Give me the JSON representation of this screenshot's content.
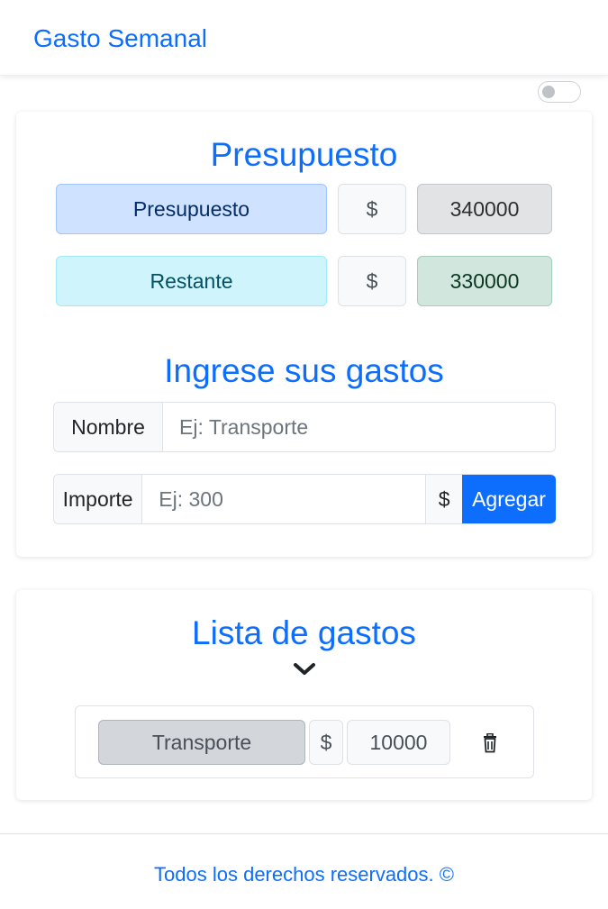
{
  "navbar": {
    "brand": "Gasto Semanal"
  },
  "theme_toggle": {
    "state": "off"
  },
  "budget": {
    "title": "Presupuesto",
    "budget_label": "Presupuesto",
    "budget_currency": "$",
    "budget_value": "340000",
    "remaining_label": "Restante",
    "remaining_currency": "$",
    "remaining_value": "330000"
  },
  "form": {
    "title": "Ingrese sus gastos",
    "name_label": "Nombre",
    "name_placeholder": "Ej: Transporte",
    "amount_label": "Importe",
    "amount_placeholder": "Ej: 300",
    "amount_currency": "$",
    "submit_label": "Agregar"
  },
  "expenses": {
    "title": "Lista de gastos",
    "items": [
      {
        "name": "Transporte",
        "currency": "$",
        "amount": "10000"
      }
    ]
  },
  "footer": {
    "text": "Todos los derechos reservados. ©"
  },
  "colors": {
    "primary": "#0d6efd",
    "budget_bg": "#cfe2ff",
    "remaining_bg": "#cff4fc",
    "remaining_value_bg": "#d1e7dd",
    "budget_value_bg": "#e2e3e5"
  }
}
